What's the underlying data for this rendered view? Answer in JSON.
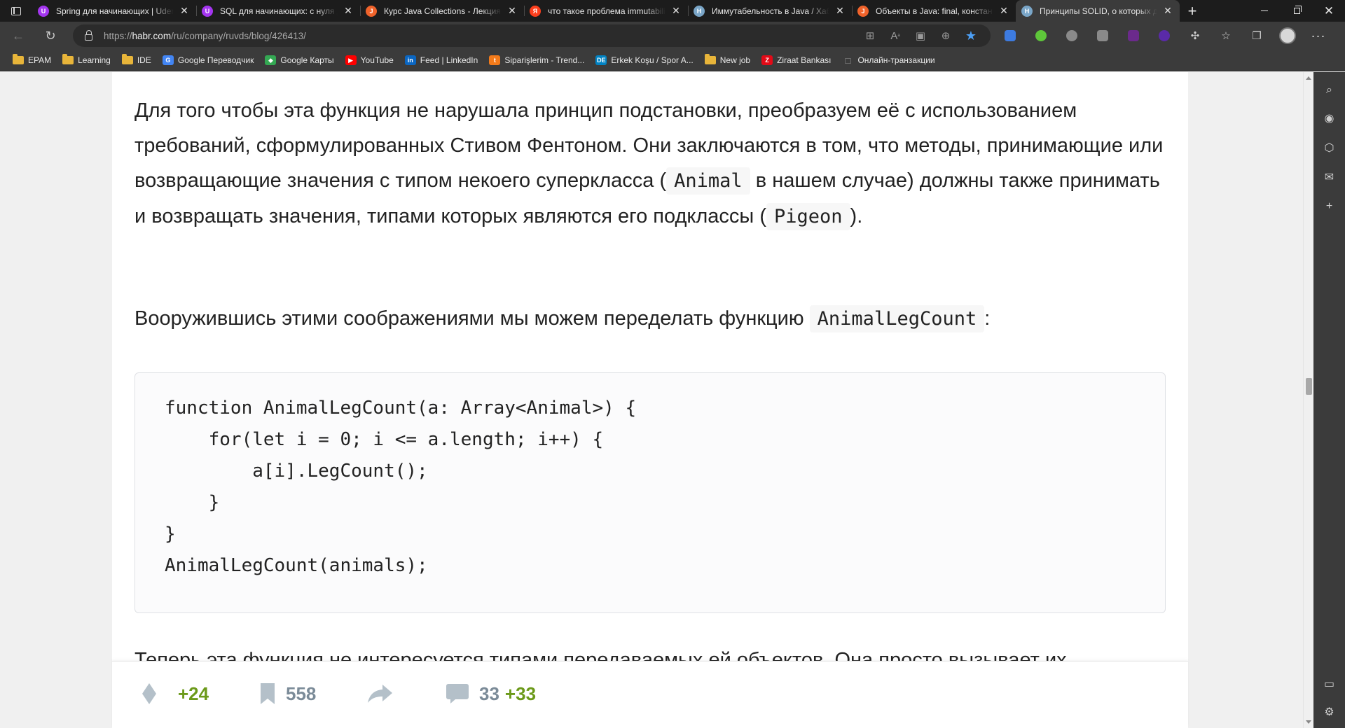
{
  "browser": {
    "tabs": [
      {
        "title": "Spring для начинающих | Udemy",
        "favicon": "udemy-icon",
        "color": "#a435f0",
        "glyph": "U",
        "active": false
      },
      {
        "title": "SQL для начинающих: с нуля до сертификата",
        "favicon": "udemy-icon",
        "color": "#a435f0",
        "glyph": "U",
        "active": false
      },
      {
        "title": "Курс Java Collections - Лекция: ...",
        "favicon": "javarush-icon",
        "color": "#f0632b",
        "glyph": "J",
        "active": false
      },
      {
        "title": "что такое проблема immutability в java",
        "favicon": "yandex-icon",
        "color": "#fc3f1d",
        "glyph": "Я",
        "active": false
      },
      {
        "title": "Иммутабельность в Java / Хабр",
        "favicon": "habr-icon",
        "color": "#7aa6c8",
        "glyph": "H",
        "active": false
      },
      {
        "title": "Объекты в Java: final, константы и ...",
        "favicon": "javarush-icon",
        "color": "#f0632b",
        "glyph": "J",
        "active": false
      },
      {
        "title": "Принципы SOLID, о которых должен знать",
        "favicon": "habr-icon",
        "color": "#7aa6c8",
        "glyph": "H",
        "active": true
      }
    ],
    "url_prefix": "https://",
    "url_host": "habr.com",
    "url_path": "/ru/company/ruvds/blog/426413/",
    "favorites": [
      {
        "label": "EPAM",
        "icon": "folder-icon",
        "kind": "folder"
      },
      {
        "label": "Learning",
        "icon": "folder-icon",
        "kind": "folder"
      },
      {
        "label": "IDE",
        "icon": "folder-icon",
        "kind": "folder"
      },
      {
        "label": "Google Переводчик",
        "icon": "google-translate-icon",
        "kind": "site",
        "color": "#4285f4",
        "glyph": "G"
      },
      {
        "label": "Google Карты",
        "icon": "google-maps-icon",
        "kind": "site",
        "color": "#34a853",
        "glyph": "◆"
      },
      {
        "label": "YouTube",
        "icon": "youtube-icon",
        "kind": "site",
        "color": "#ff0000",
        "glyph": "▶"
      },
      {
        "label": "Feed | LinkedIn",
        "icon": "linkedin-icon",
        "kind": "site",
        "color": "#0a66c2",
        "glyph": "in"
      },
      {
        "label": "Siparişlerim - Trend...",
        "icon": "trendyol-icon",
        "kind": "site",
        "color": "#f27a1a",
        "glyph": "t"
      },
      {
        "label": "Erkek Koşu / Spor A...",
        "icon": "decathlon-icon",
        "kind": "site",
        "color": "#0082c3",
        "glyph": "DE"
      },
      {
        "label": "New job",
        "icon": "folder-icon",
        "kind": "folder"
      },
      {
        "label": "Ziraat Bankası",
        "icon": "ziraat-icon",
        "kind": "site",
        "color": "#e30a17",
        "glyph": "Z"
      },
      {
        "label": "Онлайн-транзакции",
        "icon": "page-icon",
        "kind": "page",
        "color": "#9a9a9a",
        "glyph": "□"
      }
    ]
  },
  "article": {
    "para1": {
      "t1": "Для того чтобы эта функция не нарушала принцип подстановки, преобразуем её с использованием требований, сформулированных Стивом Фентоном. Они заключаются в том, что методы, принимающие или возвращающие значения с типом некоего суперкласса (",
      "code1": "Animal",
      "t2": "в нашем случае) должны также принимать и возвращать значения, типами которых являются его подклассы (",
      "code2": "Pigeon",
      "t3": ")."
    },
    "para2": {
      "t1": "Вооружившись этими соображениями мы можем переделать функцию",
      "code1": "AnimalLegCount",
      "t2": ":"
    },
    "code_block": "function AnimalLegCount(a: Array<Animal>) {\n    for(let i = 0; i <= a.length; i++) {\n        a[i].LegCount();\n    }\n}\nAnimalLegCount(animals);",
    "para3_partial": "Теперь эта функция не интересуется типами передаваемых ей объектов. Она просто вызывает их"
  },
  "footer": {
    "rating": "+24",
    "bookmarks": "558",
    "comments": "33",
    "new_comments": "+33"
  },
  "colors": {
    "accent_green": "#6c9a1a",
    "muted_gray": "#7b8b98"
  }
}
